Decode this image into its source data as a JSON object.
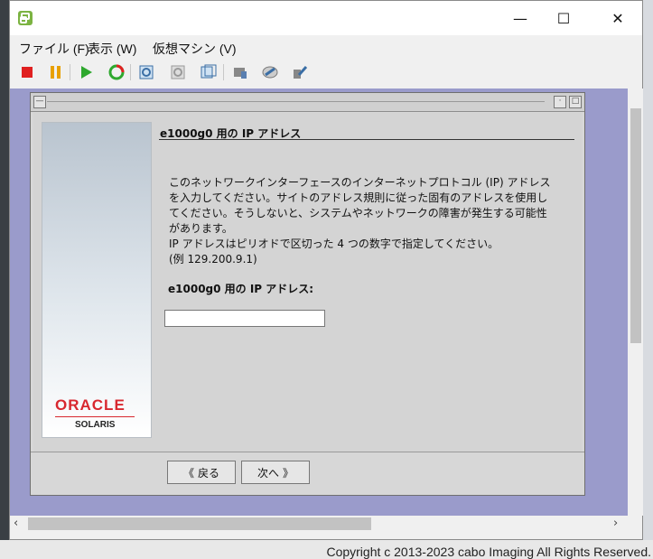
{
  "window": {
    "title": "",
    "controls": [
      "—",
      "☐",
      "✕"
    ]
  },
  "menu": [
    {
      "label": "ファイル (F)"
    },
    {
      "label": "表示 (W)"
    },
    {
      "label": "仮想マシン (V)"
    }
  ],
  "toolbar_icons": [
    "stop-icon",
    "pause-icon",
    "play-icon",
    "reset-icon",
    "snapshot-icon",
    "revert-icon",
    "manage-snapshots-icon",
    "settings-icon",
    "connect-icon",
    "tools-icon"
  ],
  "dialog": {
    "heading": "e1000g0 用の IP アドレス",
    "paragraph_lines": [
      "このネットワークインターフェースのインターネットプロトコル (IP) アドレス",
      "を入力してください。サイトのアドレス規則に従った固有のアドレスを使用し",
      "てください。そうしないと、システムやネットワークの障害が発生する可能性",
      "があります。",
      "IP アドレスはピリオドで区切った 4 つの数字で指定してください。",
      "(例 129.200.9.1)"
    ],
    "field_label": "e1000g0 用の IP アドレス:",
    "ip_value": "",
    "back_label": "戻る",
    "next_label": "次へ"
  },
  "brand": {
    "oracle": "ORACLE",
    "solaris": "SOLARIS"
  },
  "copyright": "Copyright c 2013-2023 cabo Imaging All Rights Reserved.",
  "colors": {
    "console_bg": "#9a9bcb",
    "oracle_red": "#d8282f"
  }
}
